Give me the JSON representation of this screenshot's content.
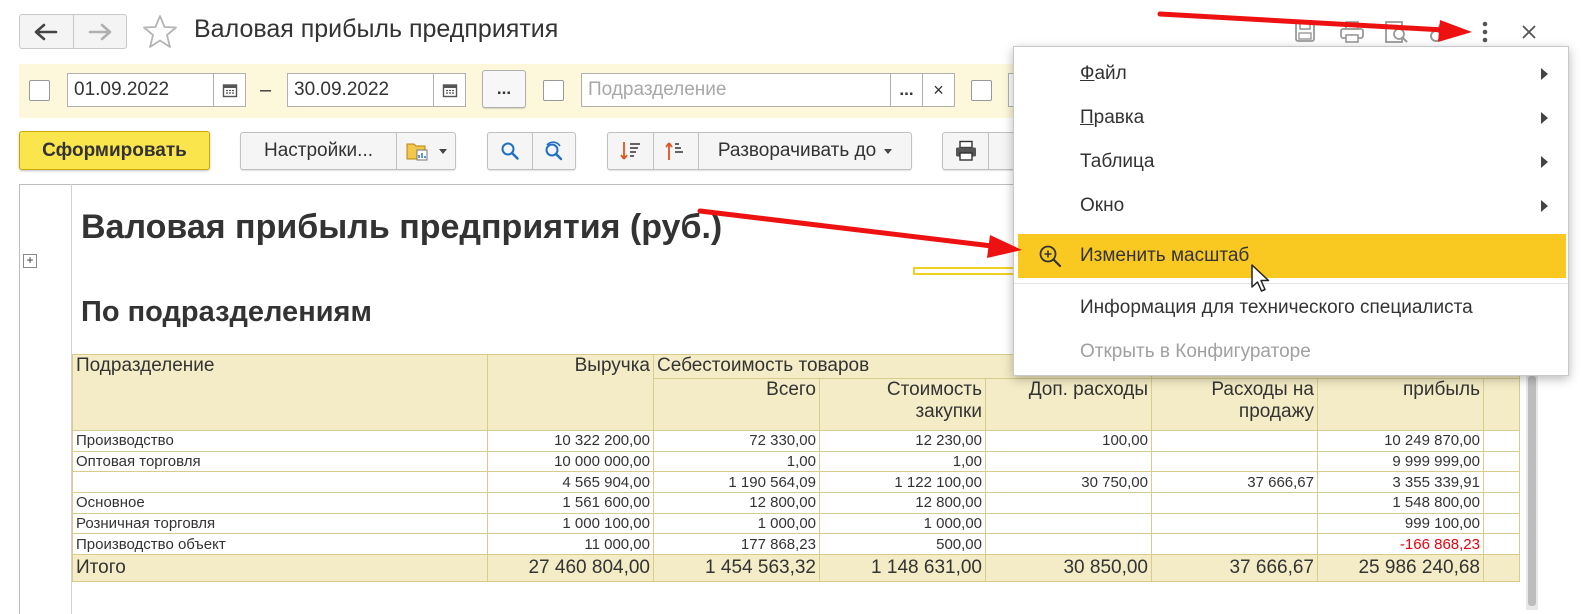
{
  "window": {
    "title": "Валовая прибыль предприятия"
  },
  "filters": {
    "date_from": "01.09.2022",
    "date_separator": "–",
    "date_to": "30.09.2022",
    "more_label": "...",
    "subdivision_placeholder": "Подразделение",
    "subdivision_select_label": "...",
    "subdivision_clear_label": "×"
  },
  "toolbar": {
    "generate_label": "Сформировать",
    "settings_label": "Настройки...",
    "expand_label": "Разворачивать до"
  },
  "report": {
    "title": "Валовая прибыль предприятия (руб.)",
    "subtitle": "По подразделениям",
    "columns": {
      "subdivision": "Подразделение",
      "revenue": "Выручка",
      "cost_group": "Себестоимость товаров",
      "total": "Всего",
      "purchase_cost_1": "Стоимость",
      "purchase_cost_2": "закупки",
      "extra_costs": "Доп. расходы",
      "sales_costs_1": "Расходы на",
      "sales_costs_2": "продажу",
      "profit": "прибыль"
    },
    "rows": [
      {
        "name": "Производство",
        "revenue": "10 322 200,00",
        "total": "72 330,00",
        "purchase": "12 230,00",
        "extra": "100,00",
        "sales": "",
        "profit": "10 249 870,00",
        "negative": false
      },
      {
        "name": "Оптовая торговля",
        "revenue": "10 000 000,00",
        "total": "1,00",
        "purchase": "1,00",
        "extra": "",
        "sales": "",
        "profit": "9 999 999,00",
        "negative": false
      },
      {
        "name": "",
        "revenue": "4 565 904,00",
        "total": "1 190 564,09",
        "purchase": "1 122 100,00",
        "extra": "30 750,00",
        "sales": "37 666,67",
        "profit": "3 355 339,91",
        "negative": false
      },
      {
        "name": "Основное",
        "revenue": "1 561 600,00",
        "total": "12 800,00",
        "purchase": "12 800,00",
        "extra": "",
        "sales": "",
        "profit": "1 548 800,00",
        "negative": false
      },
      {
        "name": "Розничная торговля",
        "revenue": "1 000 100,00",
        "total": "1 000,00",
        "purchase": "1 000,00",
        "extra": "",
        "sales": "",
        "profit": "999 100,00",
        "negative": false
      },
      {
        "name": "Производство объект",
        "revenue": "11 000,00",
        "total": "177 868,23",
        "purchase": "500,00",
        "extra": "",
        "sales": "",
        "profit": "-166 868,23",
        "negative": true
      }
    ],
    "totals": {
      "label": "Итого",
      "revenue": "27 460 804,00",
      "total": "1 454 563,32",
      "purchase": "1 148 631,00",
      "extra": "30 850,00",
      "sales": "37 666,67",
      "profit": "25 986 240,68"
    }
  },
  "menu": {
    "items": [
      {
        "label": "Файл",
        "accel": "Ф",
        "rest": "айл",
        "submenu": true
      },
      {
        "label": "Правка",
        "accel": "П",
        "rest": "равка",
        "submenu": true
      },
      {
        "label": "Таблица",
        "submenu": true
      },
      {
        "label": "Окно",
        "submenu": true
      },
      {
        "label": "Изменить масштаб",
        "active": true,
        "icon": "zoom-in-icon"
      },
      {
        "label": "Информация для технического специалиста"
      },
      {
        "label": "Открыть в Конфигураторе",
        "disabled": true
      }
    ]
  },
  "colors": {
    "accent_yellow": "#fbe54d",
    "menu_highlight": "#f9c922",
    "filter_bg": "#fdf8dc",
    "header_bg": "#f3ecc6",
    "negative": "#e8000b",
    "annotation_arrow": "#ee1111"
  }
}
